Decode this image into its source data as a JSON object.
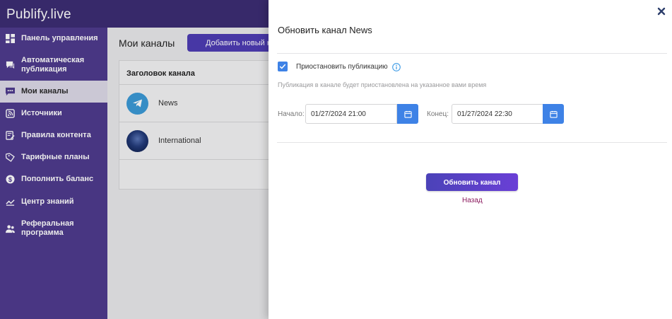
{
  "app": {
    "logo": "Publify.live"
  },
  "sidebar": {
    "items": [
      {
        "label": "Панель управления",
        "icon": "dashboard-icon"
      },
      {
        "label": "Автоматическая публикация",
        "icon": "chat-icon"
      },
      {
        "label": "Мои каналы",
        "icon": "message-dots-icon",
        "active": true
      },
      {
        "label": "Источники",
        "icon": "rss-icon"
      },
      {
        "label": "Правила контента",
        "icon": "rules-icon"
      },
      {
        "label": "Тарифные планы",
        "icon": "tag-icon"
      },
      {
        "label": "Пополнить баланс",
        "icon": "dollar-icon"
      },
      {
        "label": "Центр знаний",
        "icon": "chart-icon"
      },
      {
        "label": "Реферальная программа",
        "icon": "users-icon"
      }
    ]
  },
  "main": {
    "title": "Мои каналы",
    "add_button": "Добавить новый канал",
    "table": {
      "header": "Заголовок канала",
      "rows": [
        {
          "name": "News",
          "avatar": "telegram-avatar"
        },
        {
          "name": "International",
          "avatar": "globe-avatar"
        }
      ]
    }
  },
  "modal": {
    "title": "Обновить канал News",
    "pause_label": "Приостановить публикацию",
    "pause_checked": true,
    "hint": "Публикация в канале будет приостановлена на указанное вами время",
    "start_label": "Начало:",
    "start_value": "01/27/2024 21:00",
    "end_label": "Конец:",
    "end_value": "01/27/2024 22:30",
    "update_button": "Обновить канал",
    "back_link": "Назад"
  },
  "colors": {
    "sidebar": "#4f3b8e",
    "header": "#3c2d73",
    "accent": "#3e82e6",
    "primary_button": "#5a3fcc",
    "link": "#8b1a5e"
  }
}
